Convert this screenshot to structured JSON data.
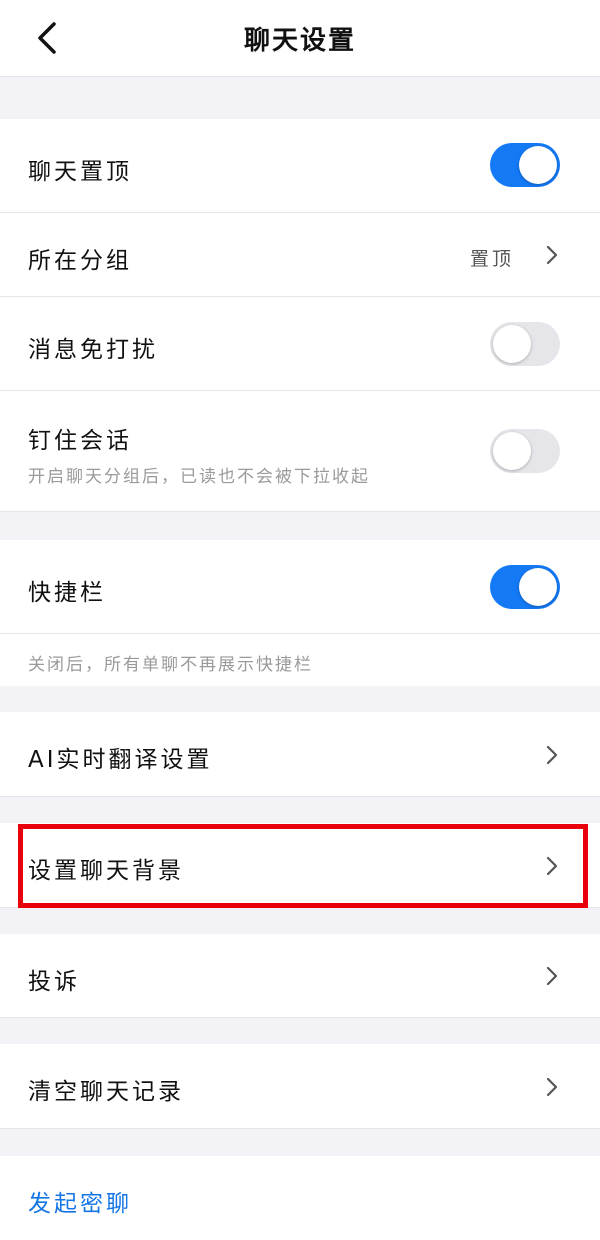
{
  "header": {
    "title": "聊天设置",
    "back_icon": "chevron-left-icon"
  },
  "colors": {
    "accent": "#1479f5",
    "highlight": "#e8000b",
    "link": "#1475e6"
  },
  "rows": {
    "pin_chat": {
      "label": "聊天置顶",
      "toggle": true
    },
    "group": {
      "label": "所在分组",
      "value": "置顶"
    },
    "mute": {
      "label": "消息免打扰",
      "toggle": false
    },
    "pin_session": {
      "label": "钉住会话",
      "subtitle": "开启聊天分组后，已读也不会被下拉收起",
      "toggle": false
    },
    "shortcut_bar": {
      "label": "快捷栏",
      "toggle": true,
      "note": "关闭后，所有单聊不再展示快捷栏"
    },
    "ai_translate": {
      "label": "AI实时翻译设置"
    },
    "set_background": {
      "label": "设置聊天背景"
    },
    "complain": {
      "label": "投诉"
    },
    "clear_history": {
      "label": "清空聊天记录"
    },
    "secret_chat": {
      "label": "发起密聊"
    }
  }
}
